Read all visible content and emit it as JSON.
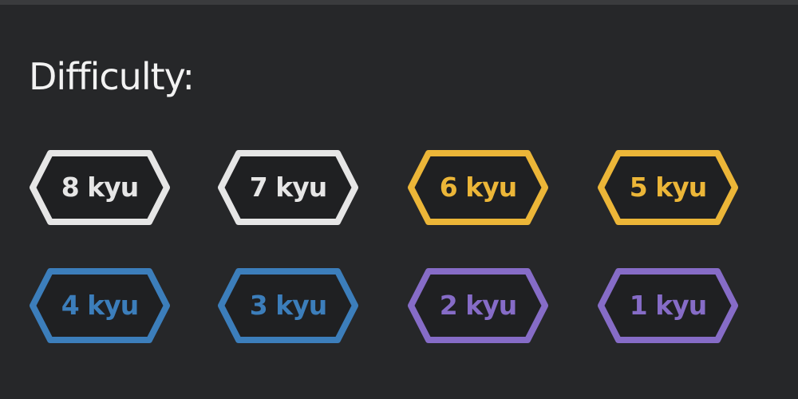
{
  "difficulty": {
    "title": "Difficulty:",
    "badges": [
      {
        "label": "8 kyu",
        "color": "#e6e6e6",
        "icon": "hexagon-badge"
      },
      {
        "label": "7 kyu",
        "color": "#e6e6e6",
        "icon": "hexagon-badge"
      },
      {
        "label": "6 kyu",
        "color": "#ecb638",
        "icon": "hexagon-badge"
      },
      {
        "label": "5 kyu",
        "color": "#ecb638",
        "icon": "hexagon-badge"
      },
      {
        "label": "4 kyu",
        "color": "#3c7ebb",
        "icon": "hexagon-badge"
      },
      {
        "label": "3 kyu",
        "color": "#3c7ebb",
        "icon": "hexagon-badge"
      },
      {
        "label": "2 kyu",
        "color": "#866cc7",
        "icon": "hexagon-badge"
      },
      {
        "label": "1 kyu",
        "color": "#866cc7",
        "icon": "hexagon-badge"
      }
    ]
  },
  "colors": {
    "background": "#262729",
    "badge_fill": "#1f2022",
    "white": "#e6e6e6",
    "yellow": "#ecb638",
    "blue": "#3c7ebb",
    "purple": "#866cc7"
  }
}
